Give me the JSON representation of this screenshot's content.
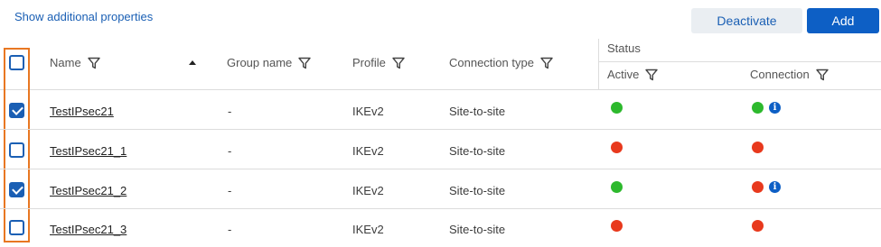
{
  "toolbar": {
    "show_props_label": "Show additional properties",
    "deactivate_label": "Deactivate",
    "add_label": "Add"
  },
  "table": {
    "headers": {
      "name": "Name",
      "group_name": "Group name",
      "profile": "Profile",
      "connection_type": "Connection type",
      "status": "Status",
      "active": "Active",
      "connection": "Connection"
    },
    "sort": {
      "column": "name",
      "direction": "ascending"
    },
    "select_all_checked": false,
    "rows": [
      {
        "checked": true,
        "name": "TestIPsec21",
        "group": "-",
        "profile": "IKEv2",
        "type": "Site-to-site",
        "active": "green",
        "connection": "green",
        "info": true
      },
      {
        "checked": false,
        "name": "TestIPsec21_1",
        "group": "-",
        "profile": "IKEv2",
        "type": "Site-to-site",
        "active": "red",
        "connection": "red",
        "info": false
      },
      {
        "checked": true,
        "name": "TestIPsec21_2",
        "group": "-",
        "profile": "IKEv2",
        "type": "Site-to-site",
        "active": "green",
        "connection": "red",
        "info": true
      },
      {
        "checked": false,
        "name": "TestIPsec21_3",
        "group": "-",
        "profile": "IKEv2",
        "type": "Site-to-site",
        "active": "red",
        "connection": "red",
        "info": false
      }
    ]
  },
  "colors": {
    "accent": "#0d5fc5",
    "status_green": "#2db92d",
    "status_red": "#e8391d",
    "selection_outline": "#e87722"
  },
  "icons": {
    "filter": "filter-funnel-icon",
    "info": "info-icon",
    "sort": "sort-ascending-icon"
  }
}
